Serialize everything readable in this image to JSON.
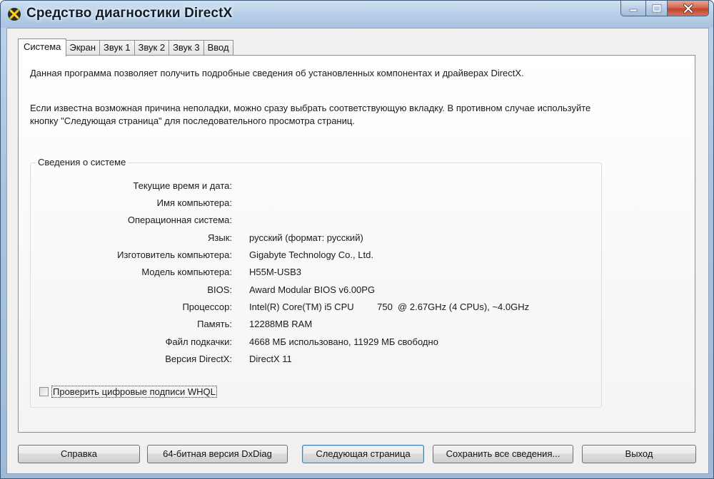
{
  "window": {
    "title": "Средство диагностики DirectX",
    "controls": [
      "minimize",
      "maximize",
      "close"
    ]
  },
  "tabs": [
    {
      "label": "Система",
      "active": true
    },
    {
      "label": "Экран",
      "active": false
    },
    {
      "label": "Звук 1",
      "active": false
    },
    {
      "label": "Звук 2",
      "active": false
    },
    {
      "label": "Звук 3",
      "active": false
    },
    {
      "label": "Ввод",
      "active": false
    }
  ],
  "panel": {
    "intro_1": "Данная программа позволяет получить подробные сведения об установленных компонентах и драйверах DirectX.",
    "intro_2": "Если известна возможная причина неполадки, можно сразу выбрать соответствующую вкладку. В противном случае используйте кнопку \"Следующая страница\" для последовательного просмотра страниц."
  },
  "system_info": {
    "group_title": "Сведения о системе",
    "rows": [
      {
        "label": "Текущие время и дата:",
        "value": ""
      },
      {
        "label": "Имя компьютера:",
        "value": ""
      },
      {
        "label": "Операционная система:",
        "value": ""
      },
      {
        "label": "Язык:",
        "value": "русский (формат: русский)"
      },
      {
        "label": "Изготовитель компьютера:",
        "value": "Gigabyte Technology Co., Ltd."
      },
      {
        "label": "Модель компьютера:",
        "value": "H55M-USB3"
      },
      {
        "label": "BIOS:",
        "value": "Award Modular BIOS v6.00PG"
      },
      {
        "label": "Процессор:",
        "value": "Intel(R) Core(TM) i5 CPU         750  @ 2.67GHz (4 CPUs), ~4.0GHz"
      },
      {
        "label": "Память:",
        "value": "12288MB RAM"
      },
      {
        "label": "Файл подкачки:",
        "value": "4668 МБ использовано, 11929 МБ свободно"
      },
      {
        "label": "Версия DirectX:",
        "value": "DirectX 11"
      }
    ]
  },
  "whql_checkbox": {
    "label": "Проверить цифровые подписи WHQL",
    "checked": false
  },
  "buttons": {
    "help": "Справка",
    "dxdiag64": "64-битная версия DxDiag",
    "next_page": "Следующая страница",
    "save_all": "Сохранить все сведения...",
    "exit": "Выход"
  },
  "colors": {
    "frame": "#a9c3e0",
    "close_button": "#c2452b",
    "client_bg": "#f0f0f0"
  }
}
